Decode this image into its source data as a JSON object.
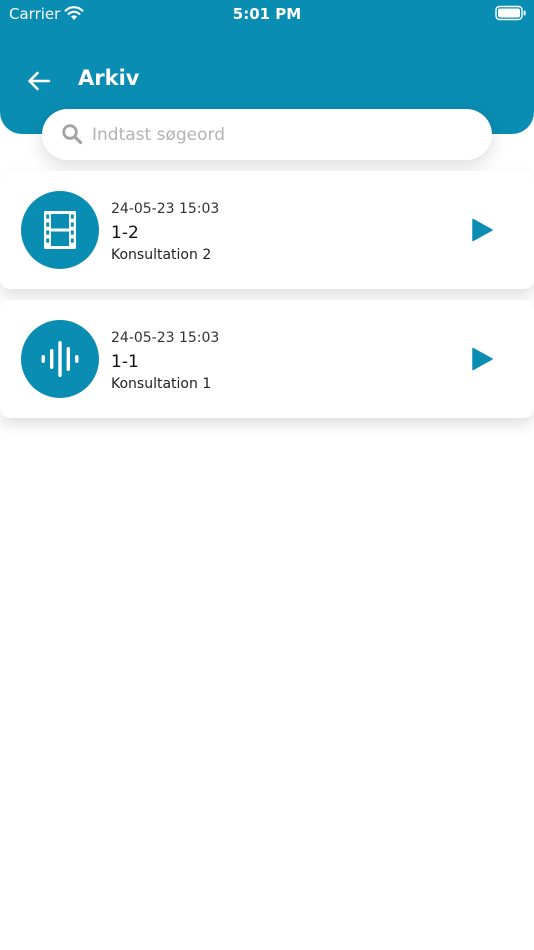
{
  "status_bar": {
    "carrier": "Carrier",
    "time": "5:01 PM"
  },
  "header": {
    "title": "Arkiv",
    "back_icon": "back-arrow-icon"
  },
  "search": {
    "placeholder": "Indtast søgeord",
    "value": "",
    "icon": "search-icon"
  },
  "recordings": [
    {
      "date": "24-05-23 15:03",
      "title": "1-2",
      "subtitle": "Konsultation 2",
      "type": "video",
      "icon": "film-icon"
    },
    {
      "date": "24-05-23 15:03",
      "title": "1-1",
      "subtitle": "Konsultation 1",
      "type": "audio",
      "icon": "audio-wave-icon"
    }
  ],
  "colors": {
    "primary": "#0a8db3",
    "background": "#ffffff",
    "card_text": "#222222",
    "placeholder": "#b3b3b3"
  }
}
